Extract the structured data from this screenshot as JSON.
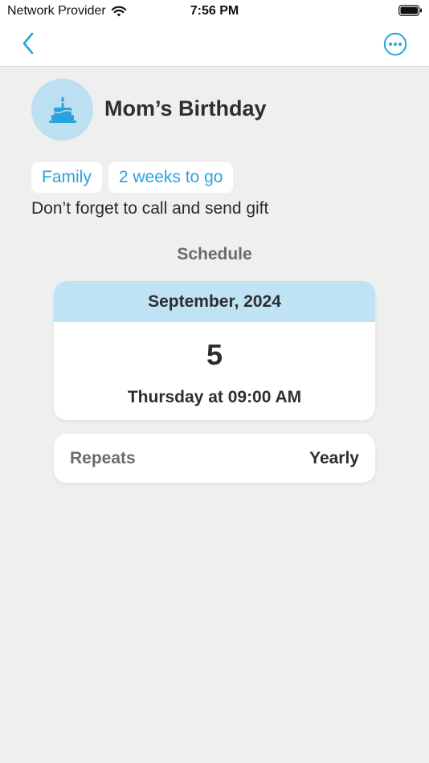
{
  "status_bar": {
    "carrier": "Network Provider",
    "time": "7:56 PM"
  },
  "nav": {
    "back_icon": "chevron-left-icon",
    "more_icon": "ellipsis-circle-icon",
    "accent_color": "#2aa2de"
  },
  "event": {
    "icon": "birthday-cake-icon",
    "title": "Mom’s Birthday",
    "tags": [
      "Family",
      "2 weeks to go"
    ],
    "note": "Don’t forget to call and send gift"
  },
  "schedule": {
    "section_title": "Schedule",
    "month_year": "September, 2024",
    "day": "5",
    "time_text": "Thursday at 09:00 AM"
  },
  "repeat": {
    "label": "Repeats",
    "value": "Yearly"
  }
}
